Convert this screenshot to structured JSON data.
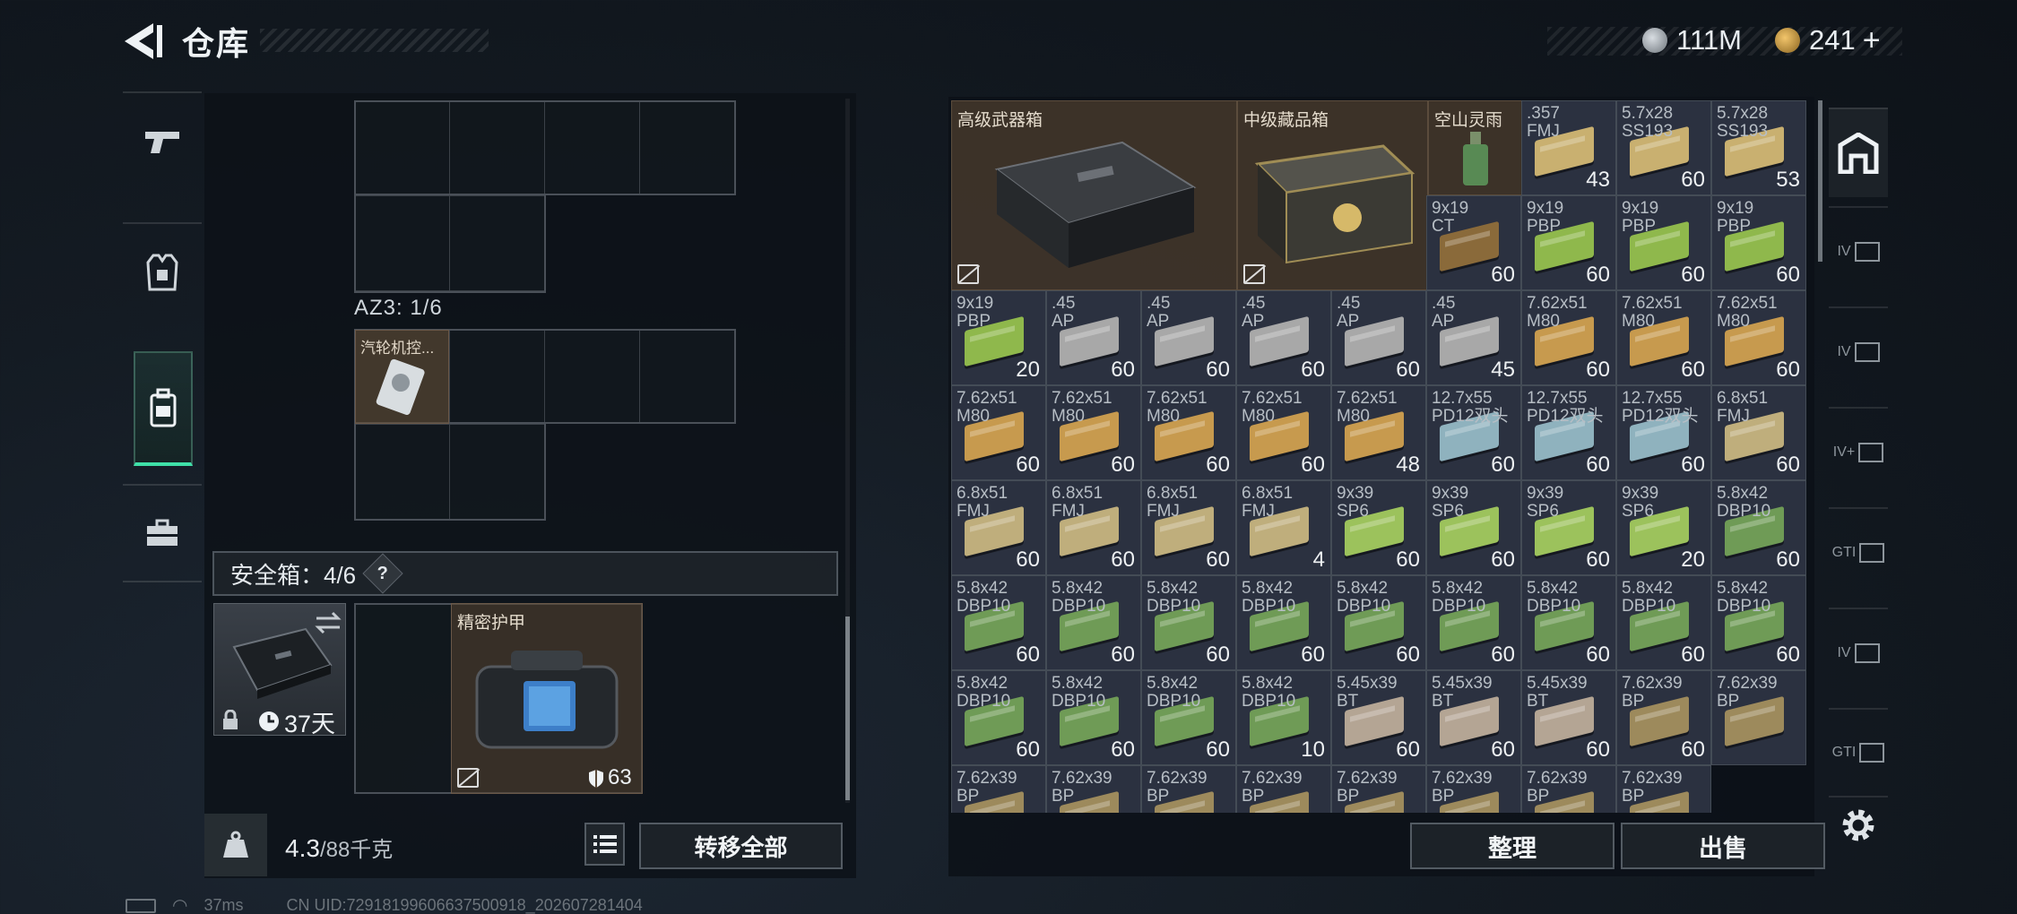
{
  "header": {
    "title": "仓库"
  },
  "currency": {
    "silver": "111M",
    "gold": "241"
  },
  "left_tabs": [
    {
      "name": "weapon-tab"
    },
    {
      "name": "armor-tab"
    },
    {
      "name": "backpack-tab",
      "active": true
    },
    {
      "name": "briefcase-tab"
    }
  ],
  "backpack": {
    "az3_label": "AZ3: 1/6",
    "item_label": "汽轮机控..."
  },
  "safe_box": {
    "label": "安全箱：4/6",
    "help": "?",
    "days": "37天",
    "armor_name": "精密护甲",
    "armor_durability": "63"
  },
  "footer": {
    "weight": "4.3",
    "weight_max": "/88千克",
    "transfer_all": "转移全部"
  },
  "stash": {
    "big_items": [
      {
        "name": "高级武器箱"
      },
      {
        "name": "中级藏品箱"
      },
      {
        "name": "空山灵雨"
      }
    ],
    "items": [
      {
        "name": ".357\nFMJ",
        "count": "43",
        "color": "#c9b070"
      },
      {
        "name": "5.7x28\nSS193",
        "count": "60",
        "color": "#c9b070"
      },
      {
        "name": "5.7x28\nSS193",
        "count": "53",
        "color": "#c9b070"
      },
      {
        "name": "9x19\nCT",
        "count": "60",
        "color": "#8a6a3a"
      },
      {
        "name": "9x19\nPBP",
        "count": "60",
        "color": "#8fb84c"
      },
      {
        "name": "9x19\nPBP",
        "count": "60",
        "color": "#8fb84c"
      },
      {
        "name": "9x19\nPBP",
        "count": "60",
        "color": "#8fb84c"
      },
      {
        "name": "9x19\nPBP",
        "count": "20",
        "color": "#8fb84c"
      },
      {
        "name": ".45\nAP",
        "count": "60",
        "color": "#a8a8a8"
      },
      {
        "name": ".45\nAP",
        "count": "60",
        "color": "#a8a8a8"
      },
      {
        "name": ".45\nAP",
        "count": "60",
        "color": "#a8a8a8"
      },
      {
        "name": ".45\nAP",
        "count": "60",
        "color": "#a8a8a8"
      },
      {
        "name": ".45\nAP",
        "count": "45",
        "color": "#a8a8a8"
      },
      {
        "name": "7.62x51\nM80",
        "count": "60",
        "color": "#c79a4e"
      },
      {
        "name": "7.62x51\nM80",
        "count": "60",
        "color": "#c79a4e"
      },
      {
        "name": "7.62x51\nM80",
        "count": "60",
        "color": "#c79a4e"
      },
      {
        "name": "7.62x51\nM80",
        "count": "60",
        "color": "#c79a4e"
      },
      {
        "name": "7.62x51\nM80",
        "count": "60",
        "color": "#c79a4e"
      },
      {
        "name": "7.62x51\nM80",
        "count": "60",
        "color": "#c79a4e"
      },
      {
        "name": "7.62x51\nM80",
        "count": "60",
        "color": "#c79a4e"
      },
      {
        "name": "7.62x51\nM80",
        "count": "48",
        "color": "#c79a4e"
      },
      {
        "name": "12.7x55\nPD12双头",
        "count": "60",
        "color": "#8fb2be"
      },
      {
        "name": "12.7x55\nPD12双头",
        "count": "60",
        "color": "#8fb2be"
      },
      {
        "name": "12.7x55\nPD12双头",
        "count": "60",
        "color": "#8fb2be"
      },
      {
        "name": "6.8x51\nFMJ",
        "count": "60",
        "color": "#bfae7c"
      },
      {
        "name": "6.8x51\nFMJ",
        "count": "60",
        "color": "#bfae7c"
      },
      {
        "name": "6.8x51\nFMJ",
        "count": "60",
        "color": "#bfae7c"
      },
      {
        "name": "6.8x51\nFMJ",
        "count": "60",
        "color": "#bfae7c"
      },
      {
        "name": "6.8x51\nFMJ",
        "count": "4",
        "color": "#bfae7c"
      },
      {
        "name": "9x39\nSP6",
        "count": "60",
        "color": "#9cc25c"
      },
      {
        "name": "9x39\nSP6",
        "count": "60",
        "color": "#9cc25c"
      },
      {
        "name": "9x39\nSP6",
        "count": "60",
        "color": "#9cc25c"
      },
      {
        "name": "9x39\nSP6",
        "count": "20",
        "color": "#9cc25c"
      },
      {
        "name": "5.8x42\nDBP10",
        "count": "60",
        "color": "#6f9b56"
      },
      {
        "name": "5.8x42\nDBP10",
        "count": "60",
        "color": "#6f9b56"
      },
      {
        "name": "5.8x42\nDBP10",
        "count": "60",
        "color": "#6f9b56"
      },
      {
        "name": "5.8x42\nDBP10",
        "count": "60",
        "color": "#6f9b56"
      },
      {
        "name": "5.8x42\nDBP10",
        "count": "60",
        "color": "#6f9b56"
      },
      {
        "name": "5.8x42\nDBP10",
        "count": "60",
        "color": "#6f9b56"
      },
      {
        "name": "5.8x42\nDBP10",
        "count": "60",
        "color": "#6f9b56"
      },
      {
        "name": "5.8x42\nDBP10",
        "count": "60",
        "color": "#6f9b56"
      },
      {
        "name": "5.8x42\nDBP10",
        "count": "60",
        "color": "#6f9b56"
      },
      {
        "name": "5.8x42\nDBP10",
        "count": "60",
        "color": "#6f9b56"
      },
      {
        "name": "5.8x42\nDBP10",
        "count": "60",
        "color": "#6f9b56"
      },
      {
        "name": "5.8x42\nDBP10",
        "count": "60",
        "color": "#6f9b56"
      },
      {
        "name": "5.8x42\nDBP10",
        "count": "60",
        "color": "#6f9b56"
      },
      {
        "name": "5.8x42\nDBP10",
        "count": "10",
        "color": "#6f9b56"
      },
      {
        "name": "5.45x39\nBT",
        "count": "60",
        "color": "#b4a594"
      },
      {
        "name": "5.45x39\nBT",
        "count": "60",
        "color": "#b4a594"
      },
      {
        "name": "5.45x39\nBT",
        "count": "60",
        "color": "#b4a594"
      },
      {
        "name": "7.62x39\nBP",
        "count": "60",
        "color": "#9d8a5c"
      },
      {
        "name": "7.62x39\nBP",
        "count": "",
        "color": "#9d8a5c"
      },
      {
        "name": "7.62x39\nBP",
        "count": "",
        "color": "#9d8a5c"
      },
      {
        "name": "7.62x39\nBP",
        "count": "",
        "color": "#9d8a5c"
      },
      {
        "name": "7.62x39\nBP",
        "count": "",
        "color": "#9d8a5c"
      },
      {
        "name": "7.62x39\nBP",
        "count": "",
        "color": "#9d8a5c"
      },
      {
        "name": "7.62x39\nBP",
        "count": "",
        "color": "#9d8a5c"
      },
      {
        "name": "7.62x39\nBP",
        "count": "",
        "color": "#9d8a5c"
      },
      {
        "name": "7.62x39\nBP",
        "count": "",
        "color": "#9d8a5c"
      },
      {
        "name": "7.62x39\nBP",
        "count": "",
        "color": "#9d8a5c"
      }
    ]
  },
  "actions": {
    "sort": "整理",
    "sell": "出售"
  },
  "right_tabs": [
    "",
    "IV",
    "IV",
    "IV+",
    "GTI",
    "IV",
    "GTI"
  ],
  "status": {
    "ping": "37ms",
    "uid": "CN UID:7291819960663750091​8_202607281404"
  }
}
